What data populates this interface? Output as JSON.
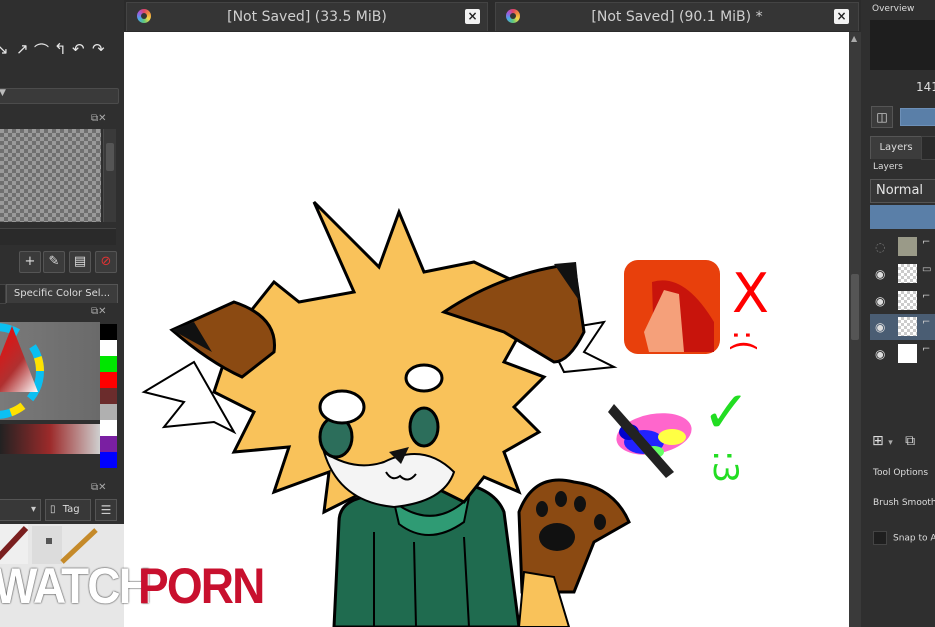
{
  "left_panel": {
    "brush_tool_glyphs": [
      "↘",
      "↗",
      "⌒",
      "↰",
      "↶",
      "↷"
    ],
    "specific_color_tab": "Specific Color Sel...",
    "swatch_colors": [
      "#000000",
      "#ffffff",
      "#00e600",
      "#ff0000",
      "#6b2c2c",
      "#b0b0b0",
      "#ffffff",
      "#7a1fa2",
      "#0000ff",
      "#00e676"
    ],
    "tag_button": "Tag"
  },
  "tabs": [
    {
      "title": "[Not Saved]  (33.5 MiB)",
      "close": "×"
    },
    {
      "title": "[Not Saved]  (90.1 MiB) *",
      "close": "×"
    }
  ],
  "canvas": {
    "reactions": {
      "bad": "X",
      "bad_face": ":(",
      "good": "✓",
      "good_face": ":3"
    }
  },
  "watermark": {
    "word1": "WATCH",
    "word2": "PORN"
  },
  "right_panel": {
    "overview_label": "Overview",
    "zoom": "141",
    "layers_tab": "Layers",
    "layers_label": "Layers",
    "blend_mode": "Normal",
    "layers": [
      {
        "thumb": "image",
        "visible": false,
        "selected": false
      },
      {
        "thumb": "checker",
        "visible": true,
        "selected": false
      },
      {
        "thumb": "checker",
        "visible": true,
        "selected": false
      },
      {
        "thumb": "checker",
        "visible": true,
        "selected": true
      },
      {
        "thumb": "white",
        "visible": true,
        "selected": false
      }
    ],
    "tool_options": "Tool Options",
    "brush_smoothing": "Brush Smoothing",
    "snap": "Snap to A"
  }
}
